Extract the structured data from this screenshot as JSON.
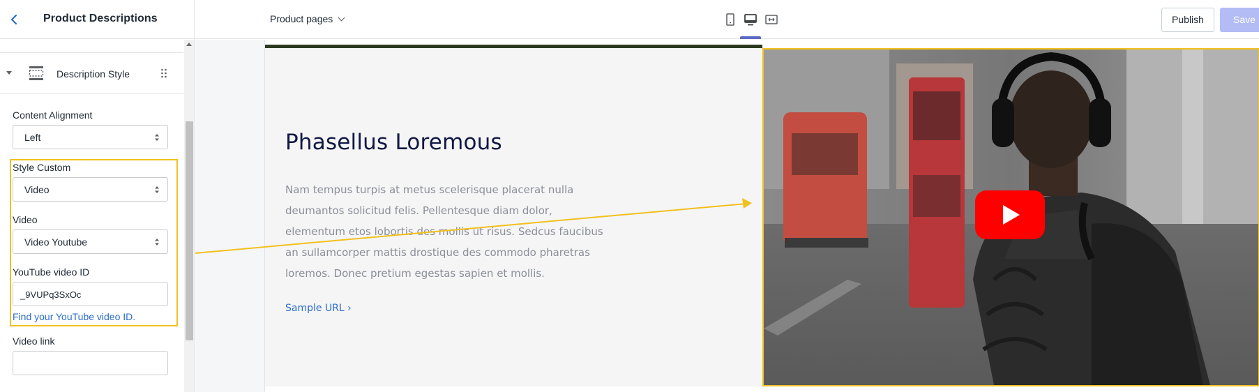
{
  "sidebar": {
    "title": "Product Descriptions",
    "section_label": "Description Style",
    "content_alignment": {
      "label": "Content Alignment",
      "value": "Left"
    },
    "style_custom": {
      "label": "Style Custom",
      "value": "Video"
    },
    "video": {
      "label": "Video",
      "value": "Video Youtube"
    },
    "youtube_id": {
      "label": "YouTube video ID",
      "value": "_9VUPq3SxOc",
      "help": "Find your YouTube video ID."
    },
    "video_link": {
      "label": "Video link",
      "value": ""
    }
  },
  "topbar": {
    "page_selector": "Product pages",
    "devices": [
      "mobile-icon",
      "desktop-icon",
      "fullwidth-icon"
    ],
    "active_device": "desktop",
    "publish_label": "Publish",
    "save_label": "Save"
  },
  "preview": {
    "heading": "Phasellus Loremous",
    "body": "Nam tempus turpis at metus scelerisque placerat nulla deumantos solicitud felis. Pellentesque diam dolor, elementum etos lobortis des mollis ut risus. Sedcus faucibus an sullamcorper mattis drostique des commodo pharetras loremos. Donec pretium egestas sapien et mollis.",
    "link": "Sample URL ›"
  },
  "colors": {
    "highlight": "#f2c01e",
    "accent": "#5c6ac4",
    "link": "#2c6ecb",
    "heading": "#101844",
    "youtube_red": "#ff0000"
  }
}
